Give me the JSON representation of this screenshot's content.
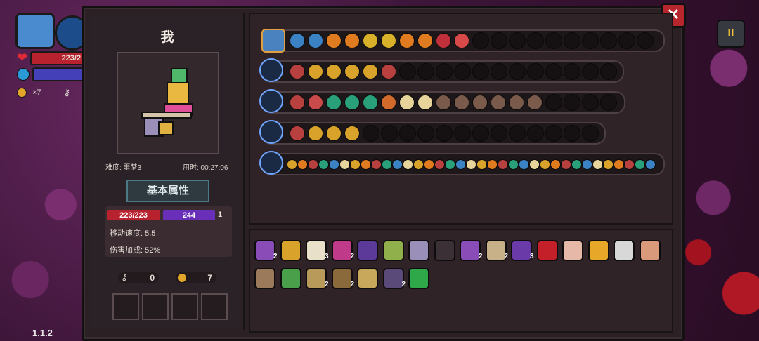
{
  "hud": {
    "hp_text": "223/2",
    "coin_count": "×7",
    "version": "1.1.2"
  },
  "panel": {
    "close_symbol": "✕",
    "player_name": "我",
    "difficulty": "难度: 噩梦3",
    "time_used": "用时: 00:27:06",
    "tab_label": "基本属性",
    "stats": {
      "hp": "223/223",
      "mana": "244",
      "armor": "1",
      "move_speed": "移动速度: 5.5",
      "damage_bonus": "伤害加成: 52%"
    },
    "keys": "0",
    "coins": "7"
  },
  "pause_symbol": "II",
  "rows": {
    "row1_icons": [
      "#3b82c4",
      "#3b82c4",
      "#e07b1f",
      "#e07b1f",
      "#d9b02a",
      "#d9b02a",
      "#e07b1f",
      "#e07b1f",
      "#c0303a",
      "#d84a4a"
    ],
    "row2_icons": [
      "#b8403e",
      "#d9a22a",
      "#d9a22a",
      "#d9a22a",
      "#d9a22a",
      "#b8403e"
    ],
    "row3_icons": [
      "#b8403e",
      "#c94a4a",
      "#2aa07a",
      "#2aa07a",
      "#2aa07a",
      "#d16a2a",
      "#e7d49a",
      "#e7d49a",
      "#7a5a4a",
      "#7a5a4a",
      "#7a5a4a",
      "#7a5a4a",
      "#7a5a4a",
      "#7a5a4a"
    ],
    "row4_icons": [
      "#b8403e",
      "#d9a22a",
      "#d9a22a",
      "#d9a22a"
    ]
  },
  "items": [
    {
      "label": "",
      "color": "#8a4db8",
      "count": "2"
    },
    {
      "label": "",
      "color": "#d9a22a",
      "count": ""
    },
    {
      "label": "",
      "color": "#e8e0c8",
      "count": "3"
    },
    {
      "label": "",
      "color": "#c03a8a",
      "count": "2"
    },
    {
      "label": "",
      "color": "#5b3a9a",
      "count": ""
    },
    {
      "label": "",
      "color": "#8fb04a",
      "count": ""
    },
    {
      "label": "",
      "color": "#9a8fb8",
      "count": ""
    },
    {
      "label": "",
      "color": "#3a3035",
      "count": ""
    },
    {
      "label": "",
      "color": "#8a4db8",
      "count": "2"
    },
    {
      "label": "",
      "color": "#c8b088",
      "count": "2"
    },
    {
      "label": "",
      "color": "#6a3aa8",
      "count": "3"
    },
    {
      "label": "",
      "color": "#c3202a",
      "count": ""
    },
    {
      "label": "",
      "color": "#e6b8a8",
      "count": ""
    },
    {
      "label": "",
      "color": "#e7a82a",
      "count": ""
    },
    {
      "label": "",
      "color": "#d8d8d8",
      "count": ""
    },
    {
      "label": "",
      "color": "#d89a7a",
      "count": ""
    },
    {
      "label": "",
      "color": "#9a7a5a",
      "count": ""
    },
    {
      "label": "",
      "color": "#4aa04a",
      "count": ""
    },
    {
      "label": "",
      "color": "#b89a5a",
      "count": "2"
    },
    {
      "label": "",
      "color": "#8a6a3a",
      "count": "2"
    },
    {
      "label": "",
      "color": "#c8a85a",
      "count": ""
    },
    {
      "label": "",
      "color": "#5a4a7a",
      "count": "2"
    },
    {
      "label": "",
      "color": "#2fa84a",
      "count": ""
    }
  ]
}
